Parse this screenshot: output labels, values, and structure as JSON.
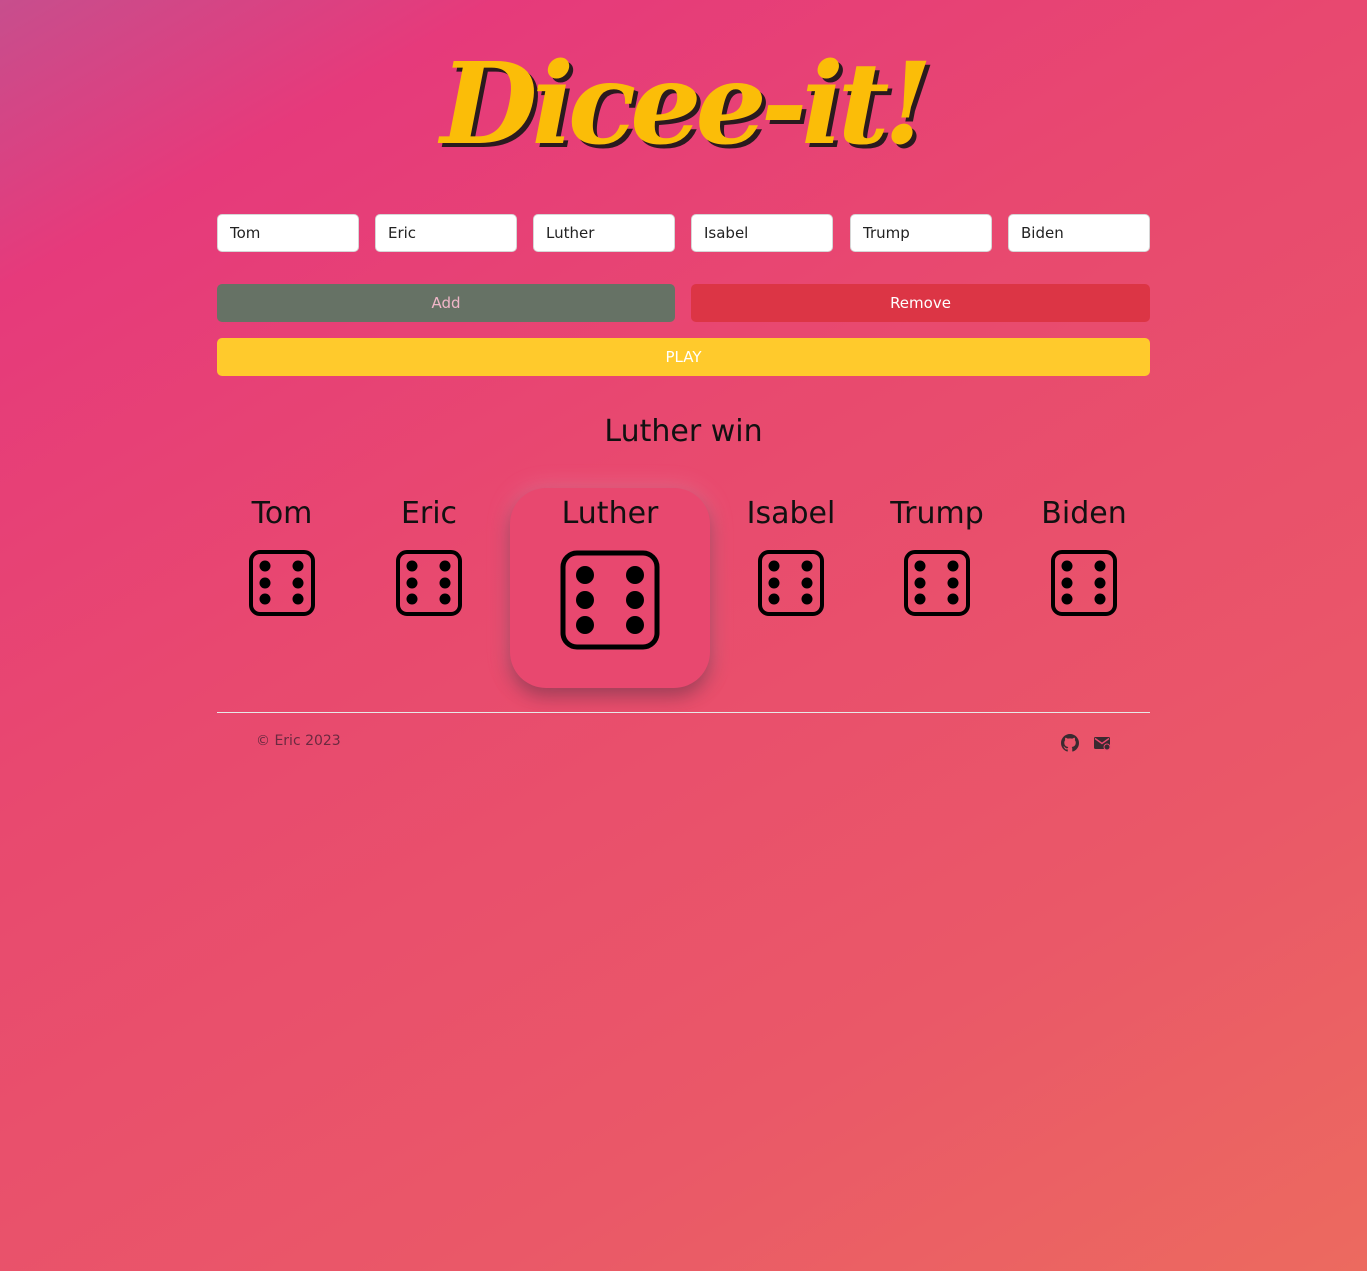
{
  "app": {
    "title": "Dicee-it!"
  },
  "players": [
    "Tom",
    "Eric",
    "Luther",
    "Isabel",
    "Trump",
    "Biden"
  ],
  "buttons": {
    "add": "Add",
    "remove": "Remove",
    "play": "PLAY"
  },
  "result": {
    "text": "Luther win"
  },
  "dice": {
    "values": [
      6,
      6,
      6,
      6,
      6,
      6
    ],
    "winner_index": 2
  },
  "footer": {
    "copyright": "© Eric 2023",
    "icons": [
      "github-icon",
      "mail-icon"
    ]
  },
  "colors": {
    "title": "#fbbd08",
    "add_button": "#667265",
    "remove_button": "#dc3545",
    "play_button": "#ffca2c"
  }
}
